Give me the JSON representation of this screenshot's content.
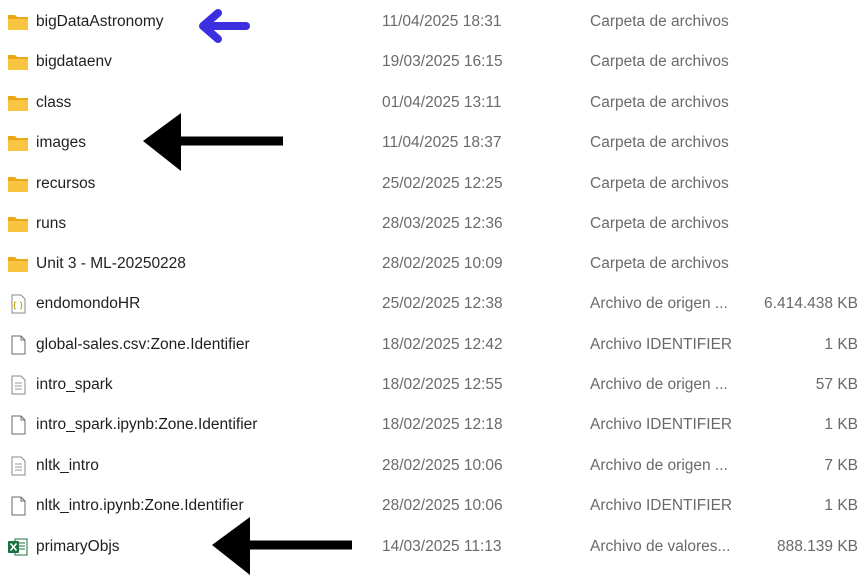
{
  "rows": [
    {
      "name": "bigDataAstronomy",
      "date": "11/04/2025 18:31",
      "type": "Carpeta de archivos",
      "size": "",
      "icon": "folder-icon"
    },
    {
      "name": "bigdataenv",
      "date": "19/03/2025 16:15",
      "type": "Carpeta de archivos",
      "size": "",
      "icon": "folder-icon"
    },
    {
      "name": "class",
      "date": "01/04/2025 13:11",
      "type": "Carpeta de archivos",
      "size": "",
      "icon": "folder-icon"
    },
    {
      "name": "images",
      "date": "11/04/2025 18:37",
      "type": "Carpeta de archivos",
      "size": "",
      "icon": "folder-icon"
    },
    {
      "name": "recursos",
      "date": "25/02/2025 12:25",
      "type": "Carpeta de archivos",
      "size": "",
      "icon": "folder-icon"
    },
    {
      "name": "runs",
      "date": "28/03/2025 12:36",
      "type": "Carpeta de archivos",
      "size": "",
      "icon": "folder-icon"
    },
    {
      "name": "Unit 3 - ML-20250228",
      "date": "28/02/2025 10:09",
      "type": "Carpeta de archivos",
      "size": "",
      "icon": "folder-icon"
    },
    {
      "name": "endomondoHR",
      "date": "25/02/2025 12:38",
      "type": "Archivo de origen ...",
      "size": "6.414.438 KB",
      "icon": "json-file-icon"
    },
    {
      "name": "global-sales.csv:Zone.Identifier",
      "date": "18/02/2025 12:42",
      "type": "Archivo IDENTIFIER",
      "size": "1 KB",
      "icon": "blank-file-icon"
    },
    {
      "name": "intro_spark",
      "date": "18/02/2025 12:55",
      "type": "Archivo de origen ...",
      "size": "57 KB",
      "icon": "text-file-icon"
    },
    {
      "name": "intro_spark.ipynb:Zone.Identifier",
      "date": "18/02/2025 12:18",
      "type": "Archivo IDENTIFIER",
      "size": "1 KB",
      "icon": "blank-file-icon"
    },
    {
      "name": "nltk_intro",
      "date": "28/02/2025 10:06",
      "type": "Archivo de origen ...",
      "size": "7 KB",
      "icon": "text-file-icon"
    },
    {
      "name": "nltk_intro.ipynb:Zone.Identifier",
      "date": "28/02/2025 10:06",
      "type": "Archivo IDENTIFIER",
      "size": "1 KB",
      "icon": "blank-file-icon"
    },
    {
      "name": "primaryObjs",
      "date": "14/03/2025 11:13",
      "type": "Archivo de valores...",
      "size": "888.139 KB",
      "icon": "excel-csv-icon"
    }
  ],
  "annotations": [
    {
      "icon": "blue-arrow-icon",
      "color": "#3b2fe0",
      "points_to": "bigDataAstronomy"
    },
    {
      "icon": "black-arrow-icon",
      "color": "#000000",
      "points_to": "images"
    },
    {
      "icon": "black-arrow-icon",
      "color": "#000000",
      "points_to": "primaryObjs"
    }
  ],
  "colors": {
    "folder": "#f8c442",
    "folder_dark": "#e8a817",
    "text_primary": "#1f1f1f",
    "text_secondary": "#6a6a6a",
    "excel_green": "#1d6f42"
  }
}
